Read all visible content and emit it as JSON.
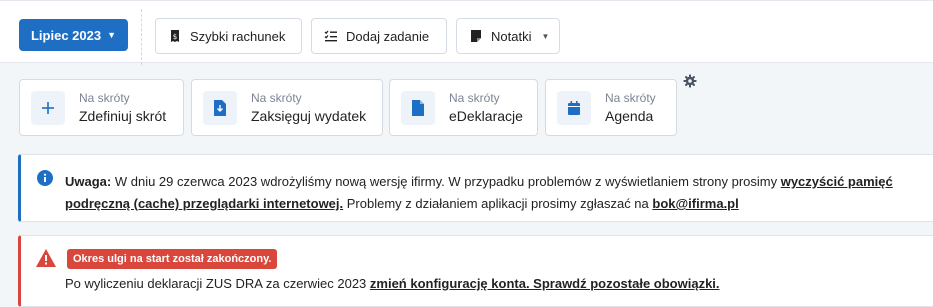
{
  "toolbar": {
    "month_label": "Lipiec 2023",
    "month_icon": "chevron-down-icon",
    "quick_invoice": "Szybki rachunek",
    "add_task": "Dodaj zadanie",
    "notes": "Notatki"
  },
  "shortcuts": [
    {
      "caption": "Na skróty",
      "label": "Zdefiniuj skrót",
      "icon": "plus-icon"
    },
    {
      "caption": "Na skróty",
      "label": "Zaksięguj wydatek",
      "icon": "file-download-icon"
    },
    {
      "caption": "Na skróty",
      "label": "eDeklaracje",
      "icon": "document-icon"
    },
    {
      "caption": "Na skróty",
      "label": "Agenda",
      "icon": "calendar-icon"
    }
  ],
  "info_alert": {
    "title": "Uwaga:",
    "text_1": " W dniu 29 czerwca 2023 wdrożyliśmy nową wersję ifirmy. W przypadku problemów z wyświetlaniem strony prosimy ",
    "link_1": "wyczyścić pamięć podręczną (cache) przeglądarki internetowej.",
    "text_2": " Problemy z działaniem aplikacji prosimy zgłaszać na ",
    "link_2": "bok@ifirma.pl"
  },
  "warning_alert": {
    "badge": "Okres ulgi na start został zakończony.",
    "text": "Po wyliczeniu deklaracji ZUS DRA za czerwiec 2023 ",
    "link": "zmień konfigurację konta. Sprawdź pozostałe obowiązki."
  },
  "colors": {
    "primary": "#1e6fc4",
    "danger": "#d9473c"
  }
}
